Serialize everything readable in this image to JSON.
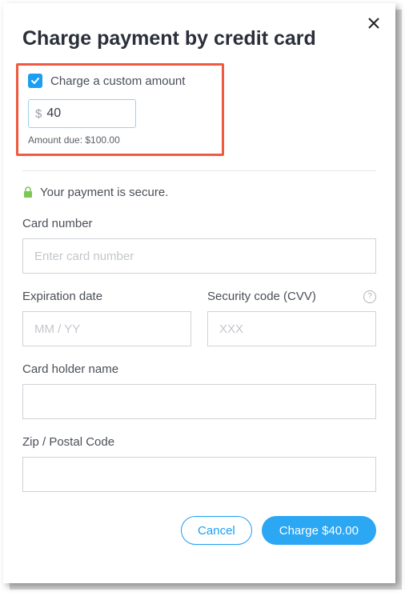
{
  "header": {
    "title": "Charge payment by credit card"
  },
  "customAmount": {
    "checkboxLabel": "Charge a custom amount",
    "currencySymbol": "$",
    "amountValue": "40",
    "amountDueLabel": "Amount due: $100.00"
  },
  "secure": {
    "text": "Your payment is secure."
  },
  "fields": {
    "cardNumber": {
      "label": "Card number",
      "placeholder": "Enter card number"
    },
    "expiration": {
      "label": "Expiration date",
      "placeholder": "MM / YY"
    },
    "cvv": {
      "label": "Security code (CVV)",
      "placeholder": "XXX"
    },
    "cardHolder": {
      "label": "Card holder name",
      "placeholder": ""
    },
    "zip": {
      "label": "Zip / Postal Code",
      "placeholder": ""
    }
  },
  "buttons": {
    "cancel": "Cancel",
    "charge": "Charge $40.00"
  }
}
